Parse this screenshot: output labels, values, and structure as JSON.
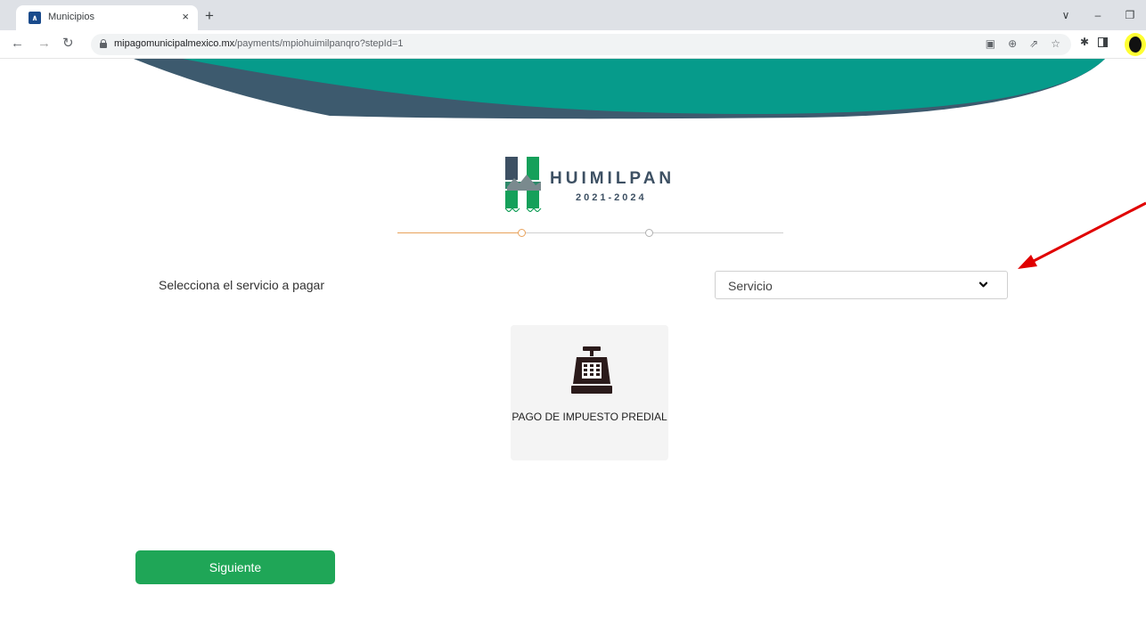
{
  "browser": {
    "tab_title": "Municipios",
    "tab_close": "×",
    "new_tab": "+",
    "url_domain": "mipagomunicipalmexico.mx",
    "url_path": "/payments/mpiohuimilpanqro?stepId=1",
    "window_controls": [
      "∨",
      "–",
      "❐"
    ]
  },
  "logo": {
    "name": "HUIMILPAN",
    "years": "2021-2024"
  },
  "form": {
    "service_label": "Selecciona el servicio a pagar",
    "service_select_value": "Servicio"
  },
  "service_card": {
    "label": "PAGO DE IMPUESTO PREDIAL"
  },
  "actions": {
    "next_label": "Siguiente"
  },
  "colors": {
    "header_teal": "#069b8b",
    "header_slate": "#3d5a6e",
    "step_active": "#e8a25b",
    "button_green": "#1fa657",
    "annotation_red": "#e00000"
  },
  "stepper": {
    "current_step": 1,
    "total_steps": 2
  }
}
